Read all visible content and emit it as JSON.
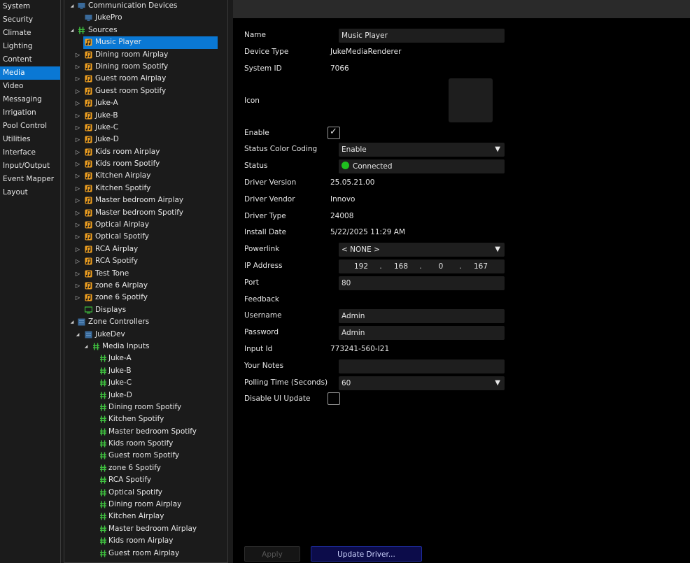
{
  "nav": {
    "items": [
      {
        "label": "System"
      },
      {
        "label": "Security"
      },
      {
        "label": "Climate"
      },
      {
        "label": "Lighting"
      },
      {
        "label": "Content"
      },
      {
        "label": "Media",
        "selected": true
      },
      {
        "label": "Video"
      },
      {
        "label": "Messaging"
      },
      {
        "label": "Irrigation"
      },
      {
        "label": "Pool Control"
      },
      {
        "label": "Utilities"
      },
      {
        "label": "Interface"
      },
      {
        "label": "Input/Output"
      },
      {
        "label": "Event Mapper"
      },
      {
        "label": "Layout"
      }
    ]
  },
  "tree": {
    "rows": [
      {
        "label": "Communication Devices",
        "level": 0,
        "expander": "expanded",
        "icon": "monitor-icon"
      },
      {
        "label": "JukePro",
        "level": 1,
        "expander": "none",
        "icon": "monitor-icon"
      },
      {
        "label": "Sources",
        "level": 0,
        "expander": "expanded",
        "icon": "plug-icon"
      },
      {
        "label": "Music Player",
        "level": 1,
        "expander": "none",
        "icon": "music-icon",
        "selected": true
      },
      {
        "label": "Dining room Airplay",
        "level": 1,
        "expander": "collapsed",
        "icon": "music-icon"
      },
      {
        "label": "Dining room Spotify",
        "level": 1,
        "expander": "collapsed",
        "icon": "music-icon"
      },
      {
        "label": "Guest room Airplay",
        "level": 1,
        "expander": "collapsed",
        "icon": "music-icon"
      },
      {
        "label": "Guest room Spotify",
        "level": 1,
        "expander": "collapsed",
        "icon": "music-icon"
      },
      {
        "label": "Juke-A",
        "level": 1,
        "expander": "collapsed",
        "icon": "music-icon"
      },
      {
        "label": "Juke-B",
        "level": 1,
        "expander": "collapsed",
        "icon": "music-icon"
      },
      {
        "label": "Juke-C",
        "level": 1,
        "expander": "collapsed",
        "icon": "music-icon"
      },
      {
        "label": "Juke-D",
        "level": 1,
        "expander": "collapsed",
        "icon": "music-icon"
      },
      {
        "label": "Kids room Airplay",
        "level": 1,
        "expander": "collapsed",
        "icon": "music-icon"
      },
      {
        "label": "Kids room Spotify",
        "level": 1,
        "expander": "collapsed",
        "icon": "music-icon"
      },
      {
        "label": "Kitchen Airplay",
        "level": 1,
        "expander": "collapsed",
        "icon": "music-icon"
      },
      {
        "label": "Kitchen Spotify",
        "level": 1,
        "expander": "collapsed",
        "icon": "music-icon"
      },
      {
        "label": "Master bedroom Airplay",
        "level": 1,
        "expander": "collapsed",
        "icon": "music-icon"
      },
      {
        "label": "Master bedroom Spotify",
        "level": 1,
        "expander": "collapsed",
        "icon": "music-icon"
      },
      {
        "label": "Optical Airplay",
        "level": 1,
        "expander": "collapsed",
        "icon": "music-icon"
      },
      {
        "label": "Optical Spotify",
        "level": 1,
        "expander": "collapsed",
        "icon": "music-icon"
      },
      {
        "label": "RCA Airplay",
        "level": 1,
        "expander": "collapsed",
        "icon": "music-icon"
      },
      {
        "label": "RCA Spotify",
        "level": 1,
        "expander": "collapsed",
        "icon": "music-icon"
      },
      {
        "label": "Test Tone",
        "level": 1,
        "expander": "collapsed",
        "icon": "music-icon"
      },
      {
        "label": "zone 6 Airplay",
        "level": 1,
        "expander": "collapsed",
        "icon": "music-icon"
      },
      {
        "label": "zone 6 Spotify",
        "level": 1,
        "expander": "collapsed",
        "icon": "music-icon"
      },
      {
        "label": "Displays",
        "level": 1,
        "expander": "none",
        "icon": "display-icon"
      },
      {
        "label": "Zone Controllers",
        "level": 0,
        "expander": "expanded",
        "icon": "controller-icon"
      },
      {
        "label": "JukeDev",
        "level": 1,
        "expander": "expanded",
        "icon": "controller-icon"
      },
      {
        "label": "Media Inputs",
        "level": 2,
        "expander": "expanded",
        "icon": "plug-icon"
      },
      {
        "label": "Juke-A",
        "level": 3,
        "expander": "none",
        "icon": "plug-icon"
      },
      {
        "label": "Juke-B",
        "level": 3,
        "expander": "none",
        "icon": "plug-icon"
      },
      {
        "label": "Juke-C",
        "level": 3,
        "expander": "none",
        "icon": "plug-icon"
      },
      {
        "label": "Juke-D",
        "level": 3,
        "expander": "none",
        "icon": "plug-icon"
      },
      {
        "label": "Dining room Spotify",
        "level": 3,
        "expander": "none",
        "icon": "plug-icon"
      },
      {
        "label": "Kitchen Spotify",
        "level": 3,
        "expander": "none",
        "icon": "plug-icon"
      },
      {
        "label": "Master bedroom Spotify",
        "level": 3,
        "expander": "none",
        "icon": "plug-icon"
      },
      {
        "label": "Kids room Spotify",
        "level": 3,
        "expander": "none",
        "icon": "plug-icon"
      },
      {
        "label": "Guest room Spotify",
        "level": 3,
        "expander": "none",
        "icon": "plug-icon"
      },
      {
        "label": "zone 6 Spotify",
        "level": 3,
        "expander": "none",
        "icon": "plug-icon"
      },
      {
        "label": "RCA Spotify",
        "level": 3,
        "expander": "none",
        "icon": "plug-icon"
      },
      {
        "label": "Optical Spotify",
        "level": 3,
        "expander": "none",
        "icon": "plug-icon"
      },
      {
        "label": "Dining room Airplay",
        "level": 3,
        "expander": "none",
        "icon": "plug-icon"
      },
      {
        "label": "Kitchen Airplay",
        "level": 3,
        "expander": "none",
        "icon": "plug-icon"
      },
      {
        "label": "Master bedroom Airplay",
        "level": 3,
        "expander": "none",
        "icon": "plug-icon"
      },
      {
        "label": "Kids room Airplay",
        "level": 3,
        "expander": "none",
        "icon": "plug-icon"
      },
      {
        "label": "Guest room Airplay",
        "level": 3,
        "expander": "none",
        "icon": "plug-icon"
      }
    ]
  },
  "props": {
    "name_label": "Name",
    "name_value": "Music Player",
    "device_type_label": "Device Type",
    "device_type_value": "JukeMediaRenderer",
    "system_id_label": "System ID",
    "system_id_value": "7066",
    "icon_label": "Icon",
    "enable_label": "Enable",
    "enable_checked": true,
    "status_color_label": "Status Color Coding",
    "status_color_value": "Enable",
    "status_label": "Status",
    "status_value": "Connected",
    "status_color": "#1fbf1f",
    "driver_version_label": "Driver Version",
    "driver_version_value": "25.05.21.00",
    "driver_vendor_label": "Driver Vendor",
    "driver_vendor_value": "Innovo",
    "driver_type_label": "Driver Type",
    "driver_type_value": "24008",
    "install_date_label": "Install Date",
    "install_date_value": "5/22/2025 11:29 AM",
    "powerlink_label": "Powerlink",
    "powerlink_value": "< NONE >",
    "ip_label": "IP Address",
    "ip_octets": [
      "192",
      "168",
      "0",
      "167"
    ],
    "ip_sep": ".",
    "port_label": "Port",
    "port_value": "80",
    "feedback_label": "Feedback",
    "username_label": "Username",
    "username_value": "Admin",
    "password_label": "Password",
    "password_value": "Admin",
    "input_id_label": "Input Id",
    "input_id_value": "773241-560-I21",
    "notes_label": "Your Notes",
    "notes_value": "",
    "polling_label": "Polling Time (Seconds)",
    "polling_value": "60",
    "disable_ui_label": "Disable UI Update",
    "disable_ui_checked": false,
    "dropdown_arrow": "▼",
    "check_mark": "✓"
  },
  "buttons": {
    "apply": "Apply",
    "update_driver": "Update Driver..."
  },
  "colors": {
    "selection": "#0a78d4",
    "music_icon": "#f0a020",
    "plug_icon": "#3fbf3f",
    "monitor_icon": "#3a6a9a",
    "display_icon": "#3fbf3f"
  }
}
